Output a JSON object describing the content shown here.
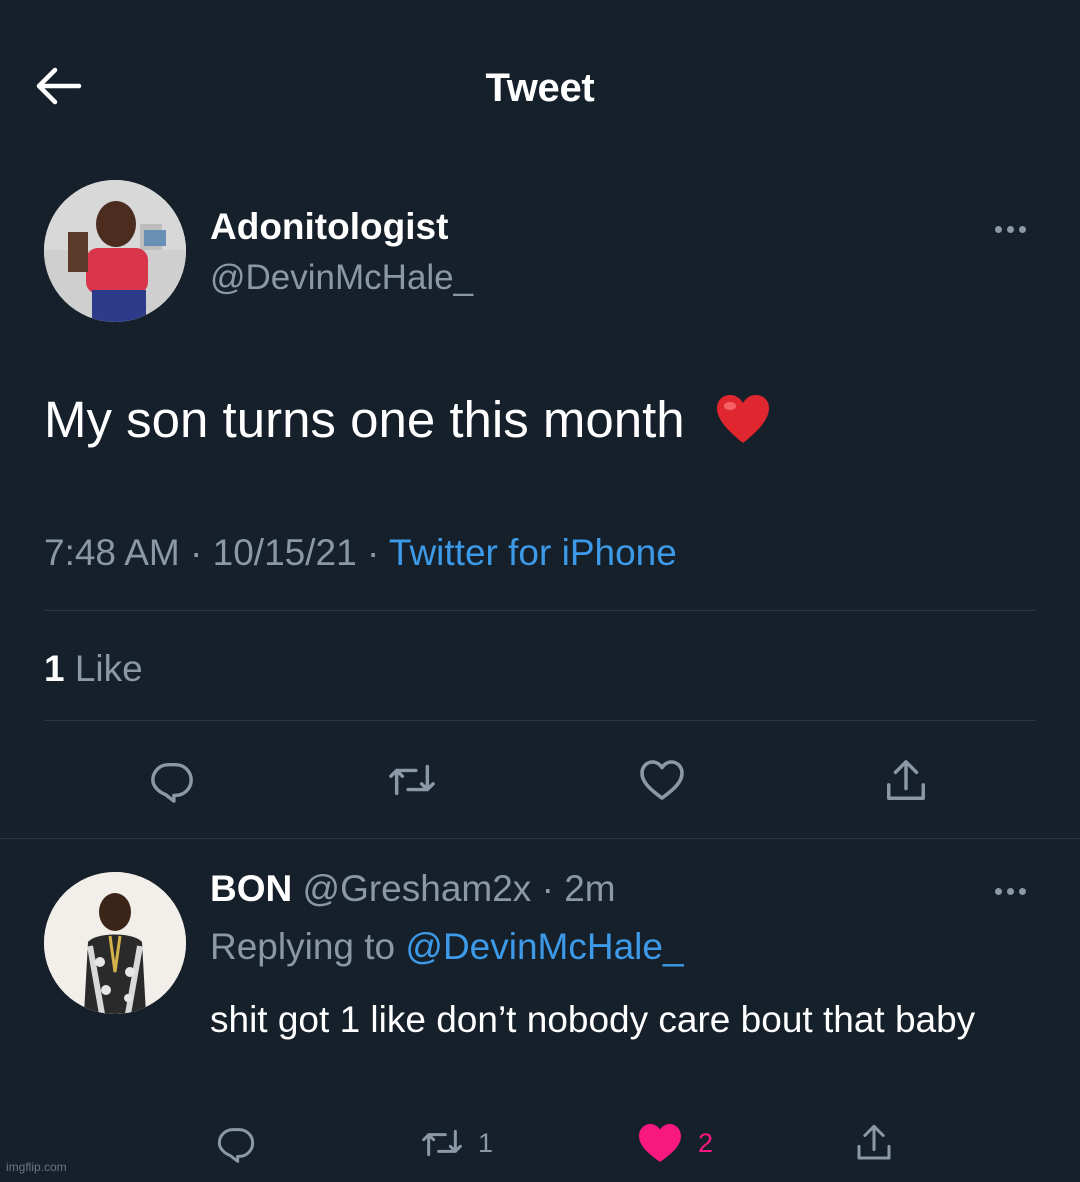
{
  "header": {
    "back_icon": "arrow-left-icon",
    "title": "Tweet"
  },
  "tweet": {
    "author_name": "Adonitologist",
    "author_handle": "@DevinMcHale_",
    "text": "My son turns one this month",
    "emoji": "red-heart-emoji",
    "time": "7:48 AM",
    "sep1": " · ",
    "date": "10/15/21",
    "sep2": " · ",
    "source": "Twitter for iPhone",
    "like_count": "1",
    "like_label": "Like",
    "actions": [
      "reply-icon",
      "retweet-icon",
      "like-icon",
      "share-icon"
    ]
  },
  "reply": {
    "author_name": "BON",
    "author_handle": "@Gresham2x",
    "sep": " · ",
    "age": "2m",
    "replying_prefix": "Replying to ",
    "replying_to": "@DevinMcHale_",
    "text": "shit got 1 like don’t nobody care bout that baby",
    "retweet_count": "1",
    "like_count": "2",
    "liked": true
  },
  "watermark": "imgflip.com",
  "colors": {
    "background": "#15202b",
    "text_primary": "#ffffff",
    "text_secondary": "#8b98a5",
    "link": "#3d9ae8",
    "like_active": "#f91880",
    "divider": "#2b3844"
  }
}
